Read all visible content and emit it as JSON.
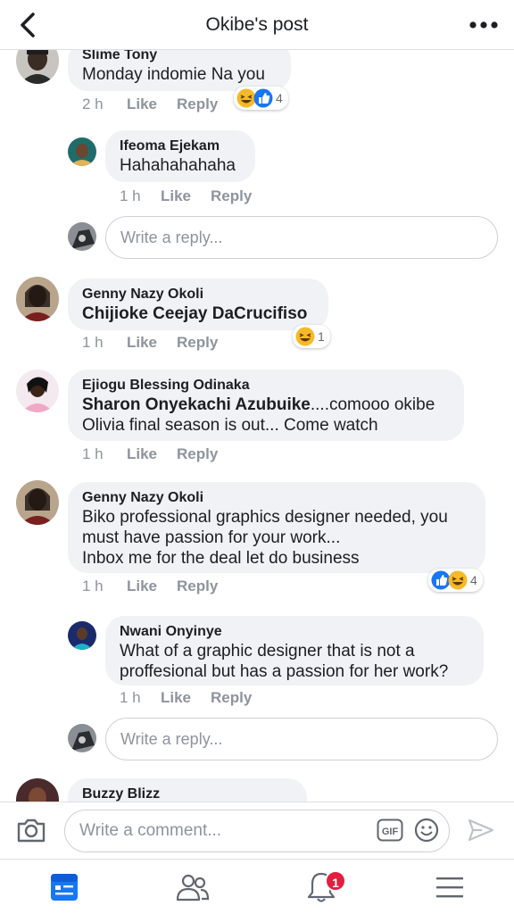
{
  "header": {
    "title": "Okibe's post"
  },
  "comments": [
    {
      "name": "Slime Tony",
      "text": "Monday indomie Na you",
      "time": "2 h",
      "like": "Like",
      "reply": "Reply",
      "reactions_count": "4"
    },
    {
      "name": "Ifeoma Ejekam",
      "text": "Hahahahahaha",
      "time": "1 h",
      "like": "Like",
      "reply": "Reply"
    },
    {
      "name": "Genny Nazy Okoli",
      "text": "Chijioke Ceejay DaCrucifiso",
      "time": "1 h",
      "like": "Like",
      "reply": "Reply",
      "reactions_count": "1"
    },
    {
      "name": "Ejiogu Blessing Odinaka",
      "mention": "Sharon Onyekachi Azubuike",
      "text1": "....comooo okibe",
      "text2": "Olivia final season is out... Come watch",
      "time": "1 h",
      "like": "Like",
      "reply": "Reply"
    },
    {
      "name": "Genny Nazy Okoli",
      "line1": "Biko professional graphics designer needed, you",
      "line2": "must have passion for your work...",
      "line3": "Inbox me for the deal let do business",
      "time": "1 h",
      "like": "Like",
      "reply": "Reply",
      "reactions_count": "4"
    },
    {
      "name": "Nwani Onyinye",
      "line1": "What of a graphic designer that is not a",
      "line2": "proffesional but has a passion for her work?",
      "time": "1 h",
      "like": "Like",
      "reply": "Reply"
    },
    {
      "name": "Buzzy Blizz"
    }
  ],
  "reply_placeholder": "Write a reply...",
  "composer": {
    "placeholder": "Write a comment..."
  },
  "tabbar": {
    "notifications_badge": "1"
  },
  "colors": {
    "accent": "#1877f2",
    "bubble": "#f0f2f5",
    "badge": "#e41e3f",
    "meta": "#8d949e"
  },
  "icons": [
    "back-arrow-icon",
    "more-icon",
    "haha-reaction-icon",
    "like-reaction-icon",
    "camera-icon",
    "gif-icon",
    "emoji-icon",
    "send-icon",
    "news-feed-icon",
    "friends-icon",
    "bell-icon",
    "menu-icon"
  ]
}
